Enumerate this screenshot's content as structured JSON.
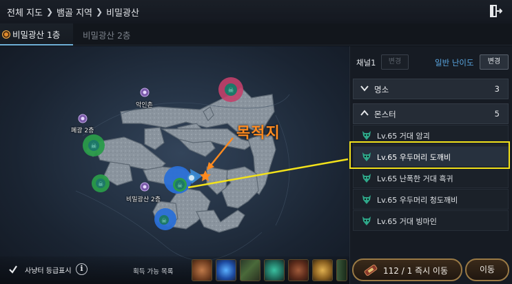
{
  "breadcrumb": {
    "items": [
      "전체 지도",
      "뱀골 지역",
      "비밀광산"
    ]
  },
  "tabs": [
    {
      "label": "비밀광산 1층",
      "active": true
    },
    {
      "label": "비밀광산 2층",
      "active": false
    }
  ],
  "map": {
    "pois": [
      {
        "label": "악인촌"
      },
      {
        "label": "폐광 2층"
      },
      {
        "label": "비밀광산 2층"
      }
    ],
    "destination_annotation": "목적지"
  },
  "bottom": {
    "hunting_grade_label": "사냥터 등급표시",
    "hunting_grade_checked": true,
    "loot_label": "획득 가능 목록"
  },
  "panel": {
    "channel_label": "채널1",
    "channel_button": "변경",
    "difficulty_label": "일반 난이도",
    "difficulty_button": "변경",
    "sections": [
      {
        "title": "명소",
        "count": "3",
        "expanded": false
      },
      {
        "title": "몬스터",
        "count": "5",
        "expanded": true
      }
    ],
    "monsters": [
      {
        "name": "Lv.65 거대 암괴"
      },
      {
        "name": "Lv.65 우두머리 도깨비",
        "selected": true
      },
      {
        "name": "Lv.65 난폭한 거대 흑귀"
      },
      {
        "name": "Lv.65 우두머리 청도깨비"
      },
      {
        "name": "Lv.65 거대 빙마인"
      }
    ],
    "teleport_label": "112 / 1  즉시 이동",
    "move_label": "이동"
  },
  "colors": {
    "accent_blue": "#5aa7e2",
    "annotation_orange": "#ff8a1f",
    "highlight_yellow": "#f3e21a",
    "monster_icon_green": "#2fa88a"
  }
}
